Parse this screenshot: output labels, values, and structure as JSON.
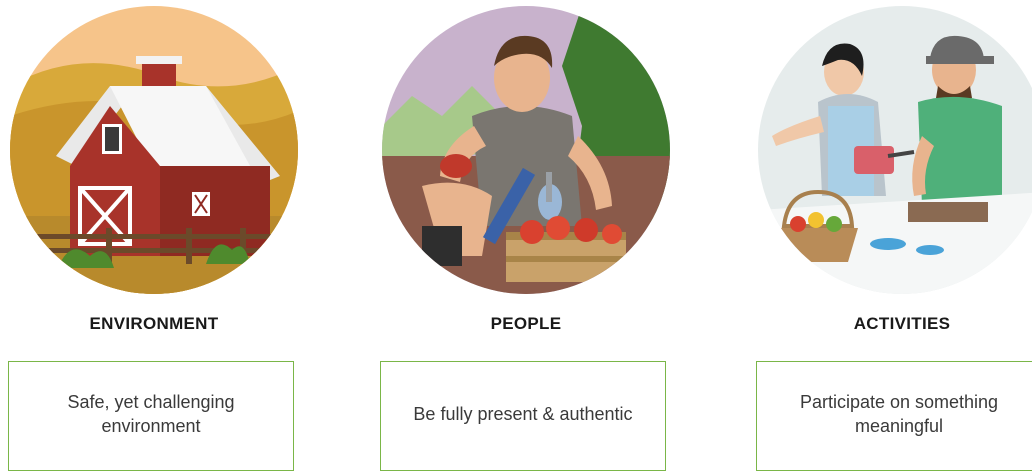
{
  "columns": [
    {
      "heading": "ENVIRONMENT",
      "description": "Safe, yet challenging environment",
      "illustration": "barn-illustration"
    },
    {
      "heading": "PEOPLE",
      "description": "Be fully present & authentic",
      "illustration": "person-with-prosthetic-illustration"
    },
    {
      "heading": "ACTIVITIES",
      "description": "Participate on something meaningful",
      "illustration": "cooking-together-illustration"
    }
  ],
  "colors": {
    "card_border": "#7ab648",
    "heading_text": "#1a1a1a",
    "body_text": "#3a3a3a"
  }
}
